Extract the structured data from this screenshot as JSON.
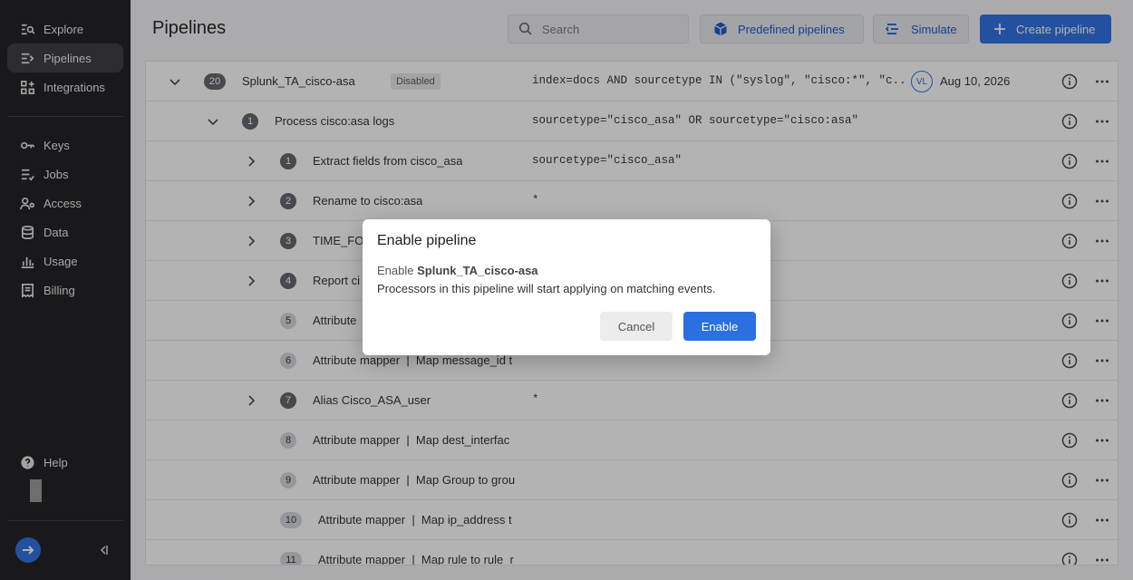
{
  "sidebar": {
    "items": [
      {
        "label": "Explore",
        "icon": "explore-icon"
      },
      {
        "label": "Pipelines",
        "icon": "pipelines-icon",
        "active": true
      },
      {
        "label": "Integrations",
        "icon": "integrations-icon"
      },
      {
        "label": "Keys",
        "icon": "key-icon"
      },
      {
        "label": "Jobs",
        "icon": "jobs-icon"
      },
      {
        "label": "Access",
        "icon": "access-icon"
      },
      {
        "label": "Data",
        "icon": "database-icon"
      },
      {
        "label": "Usage",
        "icon": "bar-chart-icon"
      },
      {
        "label": "Billing",
        "icon": "billing-icon"
      }
    ],
    "help_label": "Help"
  },
  "header": {
    "title": "Pipelines",
    "search_placeholder": "Search",
    "predefined_label": "Predefined pipelines",
    "simulate_label": "Simulate",
    "create_label": "Create pipeline"
  },
  "table": {
    "rows": [
      {
        "num": "20",
        "name": "Splunk_TA_cisco-asa",
        "badge": "Disabled",
        "query": "index=docs AND sourcetype IN (\"syslog\", \"cisco:*\", \"c...",
        "avatar": "VL",
        "date": "Aug 10, 2026"
      },
      {
        "num": "1",
        "name": "Process cisco:asa logs",
        "query": "sourcetype=\"cisco_asa\" OR sourcetype=\"cisco:asa\""
      },
      {
        "num": "1",
        "name": "Extract fields from cisco_asa",
        "query": "sourcetype=\"cisco_asa\""
      },
      {
        "num": "2",
        "name": "Rename to cisco:asa",
        "query": "*"
      },
      {
        "num": "3",
        "name": "TIME_FO",
        "query": ""
      },
      {
        "num": "4",
        "name": "Report ci",
        "query": ""
      },
      {
        "num": "5",
        "name": "Attribute",
        "query": ""
      },
      {
        "num": "6",
        "name": "Attribute mapper  |  Map message_id t",
        "query": ""
      },
      {
        "num": "7",
        "name": "Alias Cisco_ASA_user",
        "query": "*"
      },
      {
        "num": "8",
        "name": "Attribute mapper  |  Map dest_interfac",
        "query": ""
      },
      {
        "num": "9",
        "name": "Attribute mapper  |  Map Group to grou",
        "query": ""
      },
      {
        "num": "10",
        "name": "Attribute mapper  |  Map ip_address t",
        "query": ""
      },
      {
        "num": "11",
        "name": "Attribute mapper  |  Map rule to rule_r",
        "query": ""
      }
    ]
  },
  "dialog": {
    "title": "Enable pipeline",
    "prefix": "Enable",
    "pipeline_name": "Splunk_TA_cisco-asa",
    "message": "Processors in this pipeline will start applying on matching events.",
    "cancel_label": "Cancel",
    "enable_label": "Enable"
  },
  "colors": {
    "accent": "#2b6fe0",
    "sidebar_bg": "#1c1c1e"
  }
}
